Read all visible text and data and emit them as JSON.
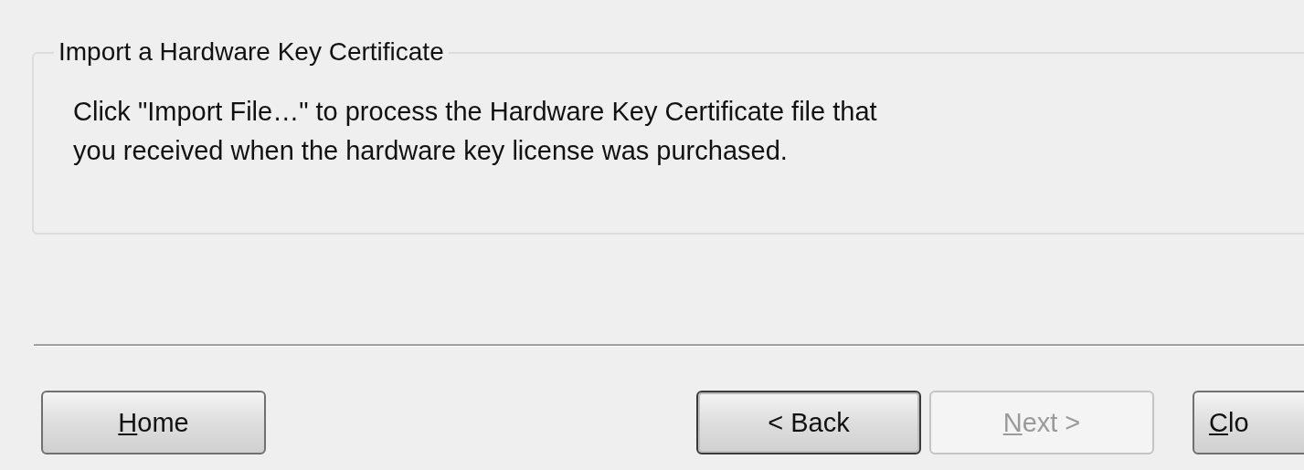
{
  "group": {
    "title": "Import a Hardware Key Certificate",
    "text": "Click \"Import File…\" to process the Hardware Key Certificate file that\nyou received when the hardware key license was purchased."
  },
  "buttons": [
    {
      "key": "H",
      "post": "ome",
      "disabled": false,
      "default": false
    },
    {
      "pre": "< Back",
      "disabled": false,
      "default": true
    },
    {
      "key": "N",
      "post": "ext >",
      "disabled": true,
      "default": false
    },
    {
      "key": "C",
      "post": "lo",
      "disabled": false,
      "default": false
    }
  ]
}
